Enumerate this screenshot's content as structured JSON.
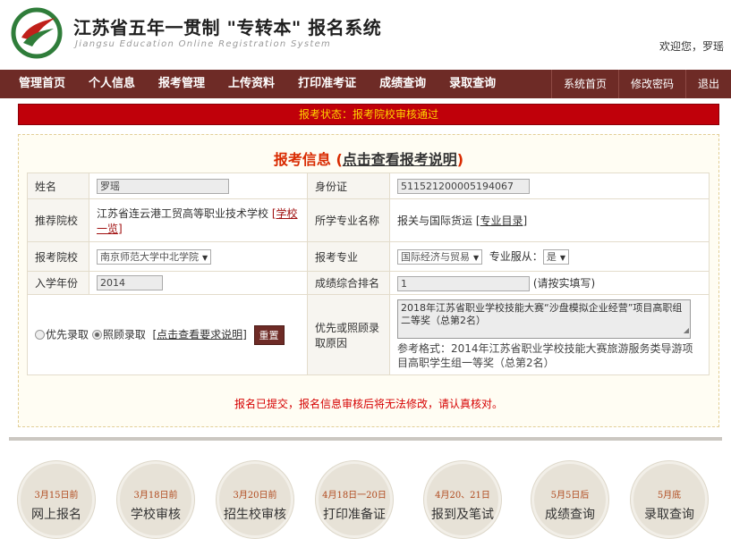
{
  "header": {
    "title": "江苏省五年一贯制 \"专转本\" 报名系统",
    "subtitle": "Jiangsu Education Online Registration System",
    "welcome": "欢迎您，罗瑶"
  },
  "nav": {
    "left": [
      "管理首页",
      "个人信息",
      "报考管理",
      "上传资料",
      "打印准考证",
      "成绩查询",
      "录取查询"
    ],
    "right": [
      "系统首页",
      "修改密码",
      "退出"
    ]
  },
  "status": "报考状态：报考院校审核通过",
  "panel": {
    "title": "报考信息 (",
    "title_link": "点击查看报考说明",
    "title_end": ")",
    "name_label": "姓名",
    "name_value": "罗瑶",
    "id_label": "身份证",
    "id_value": "511521200005194067",
    "rec_school_label": "推荐院校",
    "rec_school_value": "江苏省连云港工贸高等职业技术学校",
    "rec_school_link": "[学校一览]",
    "major_label": "所学专业名称",
    "major_value": "报关与国际货运",
    "major_link": "[专业目录]",
    "apply_school_label": "报考院校",
    "apply_school_value": "南京师范大学中北学院",
    "apply_major_label": "报考专业",
    "apply_major_value": "国际经济与贸易",
    "obey_label": "专业服从：",
    "obey_value": "是",
    "year_label": "入学年份",
    "year_value": "2014",
    "rank_label": "成绩综合排名",
    "rank_value": "1",
    "rank_hint": "(请按实填写)",
    "priority_option": "优先录取",
    "care_option": "照顾录取",
    "req_link": "[点击查看要求说明]",
    "reset_button": "重置",
    "reason_label": "优先或照顾录取原因",
    "reason_value": "2018年江苏省职业学校技能大赛“沙盘模拟企业经营”项目高职组二等奖（总第2名）",
    "reference": "参考格式：2014年江苏省职业学校技能大赛旅游服务类导游项目高职学生组一等奖（总第2名）",
    "notice": "报名已提交，报名信息审核后将无法修改，请认真核对。"
  },
  "steps": [
    {
      "date": "3月15日前",
      "name": "网上报名"
    },
    {
      "date": "3月18日前",
      "name": "学校审核"
    },
    {
      "date": "3月20日前",
      "name": "招生校审核"
    },
    {
      "date": "4月18日一20日",
      "name": "打印准备证"
    },
    {
      "date": "4月20、21日",
      "name": "报到及笔试"
    },
    {
      "date": "5月5日后",
      "name": "成绩查询"
    },
    {
      "date": "5月底",
      "name": "录取查询"
    }
  ],
  "colors": {
    "nav_bg": "#6e2b26",
    "status_bg": "#c0000a",
    "status_text": "#ffd200",
    "title_red": "#d92a00",
    "logo_green": "#2f7d3a"
  }
}
